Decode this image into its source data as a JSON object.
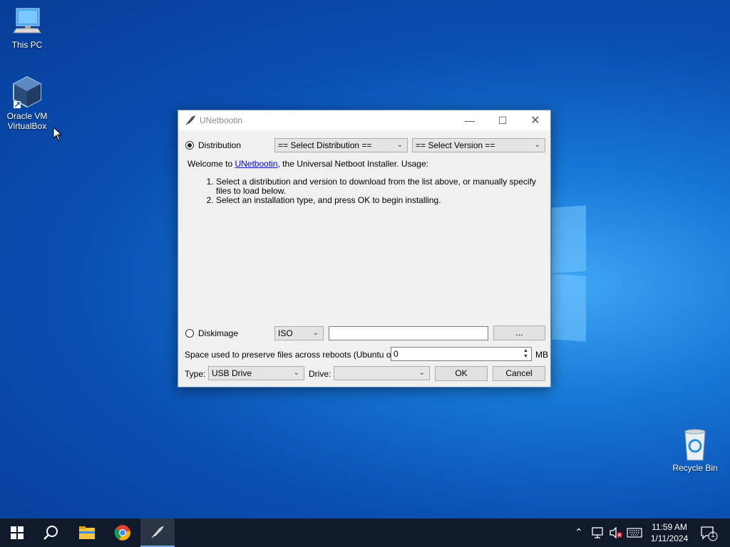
{
  "desktop": {
    "icons": [
      {
        "label": "This PC",
        "icon": "computer-icon"
      },
      {
        "label": "Oracle VM VirtualBox",
        "label_line1": "Oracle VM",
        "label_line2": "VirtualBox",
        "icon": "virtualbox-icon"
      },
      {
        "label": "Recycle Bin",
        "icon": "recycle-bin-icon"
      }
    ]
  },
  "window": {
    "title": "UNetbootin",
    "distribution_label": "Distribution",
    "distribution_select": "== Select Distribution ==",
    "version_select": "== Select Version ==",
    "welcome_prefix": "Welcome to ",
    "welcome_link": "UNetbootin",
    "welcome_suffix": ", the Universal Netboot Installer. Usage:",
    "instructions": [
      "Select a distribution and version to download from the list above, or manually specify files to load below.",
      "Select an installation type, and press OK to begin installing."
    ],
    "diskimage_label": "Diskimage",
    "diskimage_type": "ISO",
    "diskimage_path": "",
    "browse_label": "...",
    "persist_label": "Space used to preserve files across reboots (Ubuntu only):",
    "persist_value": "0",
    "persist_unit": "MB",
    "type_label": "Type:",
    "type_value": "USB Drive",
    "drive_label": "Drive:",
    "drive_value": "",
    "ok_label": "OK",
    "cancel_label": "Cancel",
    "selected_mode": "distribution"
  },
  "taskbar": {
    "items": [
      "start-icon",
      "search-icon",
      "file-explorer-icon",
      "chrome-icon",
      "unetbootin-icon"
    ],
    "time": "11:59 AM",
    "date": "1/11/2024",
    "notification_count": "1"
  },
  "colors": {
    "link": "#0000ee",
    "taskbar": "#101a2a",
    "desktop": "#1778d6"
  }
}
